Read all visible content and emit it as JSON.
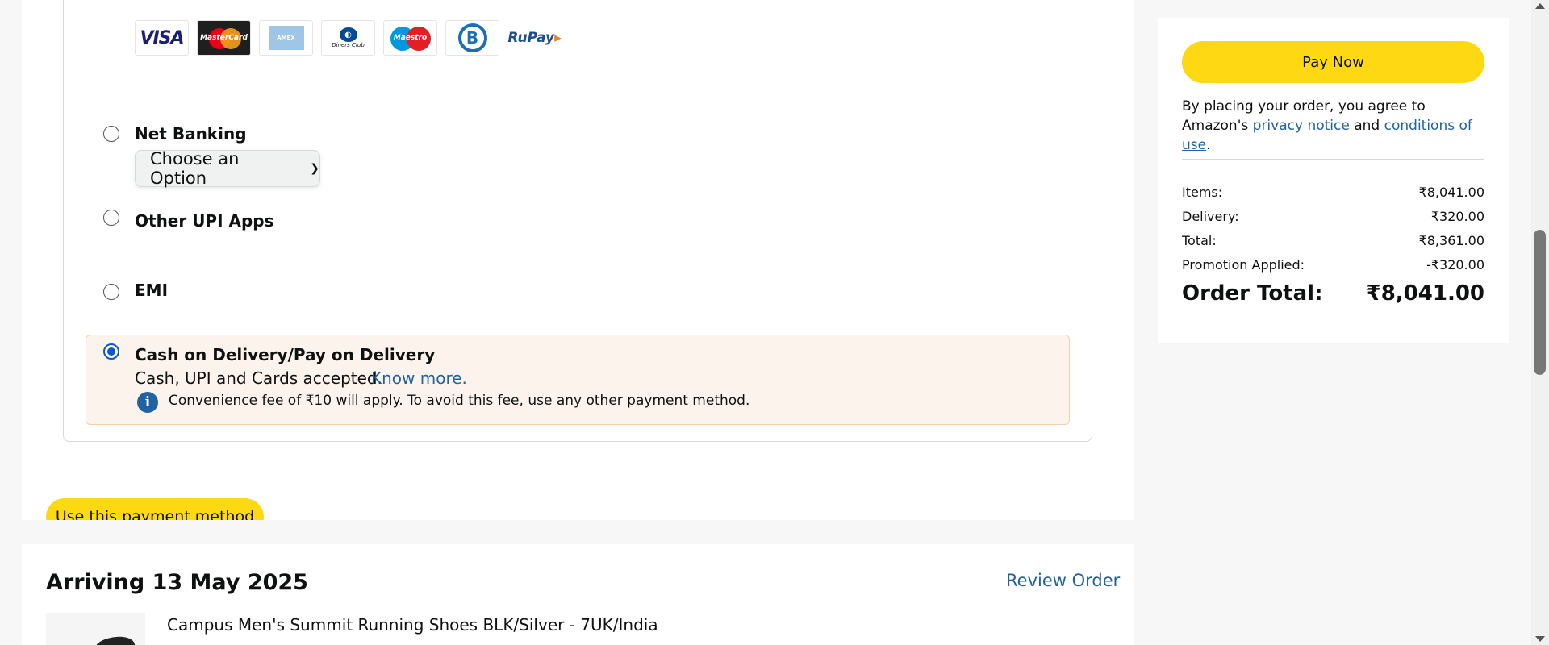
{
  "payment": {
    "card_logos": [
      "VISA",
      "MasterCard",
      "American Express",
      "Diners Club International",
      "Maestro",
      "Bajaj Finserv",
      "RuPay"
    ],
    "methods": {
      "net_banking": {
        "label": "Net Banking",
        "select_value": "Choose an Option"
      },
      "other_upi": {
        "label": "Other UPI Apps"
      },
      "emi": {
        "label": "EMI"
      },
      "cod": {
        "label": "Cash on Delivery/Pay on Delivery",
        "subtext": "Cash, UPI and Cards accepted.",
        "link": "Know more.",
        "fee_note": "Convenience fee of ₹10 will apply. To avoid this fee, use any other payment method."
      }
    },
    "use_button": "Use this payment method"
  },
  "arriving": {
    "title": "Arriving 13 May 2025",
    "review_link": "Review Order",
    "product_name": "Campus Men's Summit Running Shoes BLK/Silver - 7UK/India"
  },
  "summary": {
    "pay_now": "Pay Now",
    "agree_prefix": "By placing your order, you agree to Amazon's",
    "privacy_link": "privacy notice",
    "and_text": "and",
    "conditions_link": "conditions of use",
    "period": ".",
    "rows": [
      {
        "label": "Items:",
        "value": "₹8,041.00"
      },
      {
        "label": "Delivery:",
        "value": "₹320.00"
      },
      {
        "label": "Total:",
        "value": "₹8,361.00"
      },
      {
        "label": "Promotion Applied:",
        "value": "-₹320.00"
      }
    ],
    "order_total_label": "Order Total:",
    "order_total_value": "₹8,041.00"
  },
  "colors": {
    "accent_yellow": "#ffd814",
    "link_blue": "#2162a1",
    "radio_blue": "#0b57d0",
    "cod_bg": "#fcf4ec"
  }
}
